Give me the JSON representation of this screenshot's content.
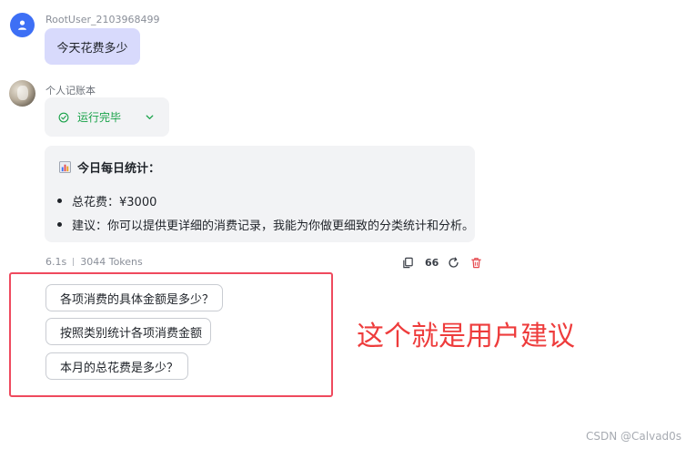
{
  "user_message": {
    "username": "RootUser_2103968499",
    "text": "今天花费多少"
  },
  "bot_message": {
    "name": "个人记账本",
    "status": "运行完毕",
    "status_color": "#1aa34a",
    "answer": {
      "title": "今日每日统计：",
      "items": [
        "总花费：¥3000",
        "建议：你可以提供更详细的消费记录，我能为你做更细致的分类统计和分析。"
      ]
    },
    "meta": {
      "duration": "6.1s",
      "tokens": "3044 Tokens"
    },
    "actions": {
      "copy_icon": "copy-icon",
      "quote_label": "66",
      "refresh_icon": "refresh-icon",
      "delete_icon": "delete-icon"
    }
  },
  "suggestions": [
    "各项消费的具体金额是多少？",
    "按照类别统计各项消费金额",
    "本月的总花费是多少？"
  ],
  "annotation": {
    "text": "这个就是用户建议",
    "color": "#ee3c3c"
  },
  "watermark": "CSDN @Calvad0s",
  "colors": {
    "user_avatar": "#3d6ff5",
    "user_bubble": "#d8dafc",
    "highlight_frame": "#ef4a5e",
    "delete_icon": "#e5484d"
  }
}
